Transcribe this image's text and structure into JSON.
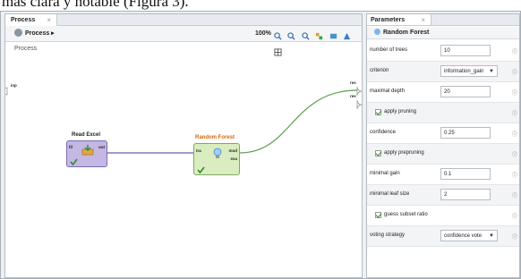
{
  "caption": "más clara y notable (Figura 3).",
  "process_panel": {
    "tab_label": "Process",
    "breadcrumb": "Process ▸",
    "zoom": "100%",
    "canvas_label": "Process",
    "inp_port": "inp",
    "res_ports": [
      "res",
      "res"
    ],
    "operators": [
      {
        "title": "Read Excel",
        "ports_in": [
          "fil"
        ],
        "ports_out": [
          "out"
        ],
        "color": "#c4b7e3"
      },
      {
        "title": "Random Forest",
        "ports_in": [
          "tra"
        ],
        "ports_out": [
          "mod",
          "exa"
        ],
        "color": "#d9edc0"
      }
    ]
  },
  "params_panel": {
    "tab_label": "Parameters",
    "operator_title": "Random Forest",
    "rows": [
      {
        "type": "input",
        "label": "number of trees",
        "value": "10"
      },
      {
        "type": "select",
        "label": "criterion",
        "value": "information_gain"
      },
      {
        "type": "input",
        "label": "maximal depth",
        "value": "20"
      },
      {
        "type": "check",
        "label": "apply pruning"
      },
      {
        "type": "input",
        "label": "confidence",
        "value": "0.25"
      },
      {
        "type": "check",
        "label": "apply prepruning"
      },
      {
        "type": "input",
        "label": "minimal gain",
        "value": "0.1"
      },
      {
        "type": "input",
        "label": "minimal leaf size",
        "value": "2"
      },
      {
        "type": "check",
        "label": "guess subset ratio"
      },
      {
        "type": "select",
        "label": "voting strategy",
        "value": "confidence vote"
      }
    ],
    "info_glyph": "ⓘ"
  },
  "colors": {
    "read_excel_op": "#c4b7e3",
    "random_forest_op": "#d9edc0",
    "connection_green": "#5c9c4a",
    "connection_purple": "#6a5ca8"
  }
}
